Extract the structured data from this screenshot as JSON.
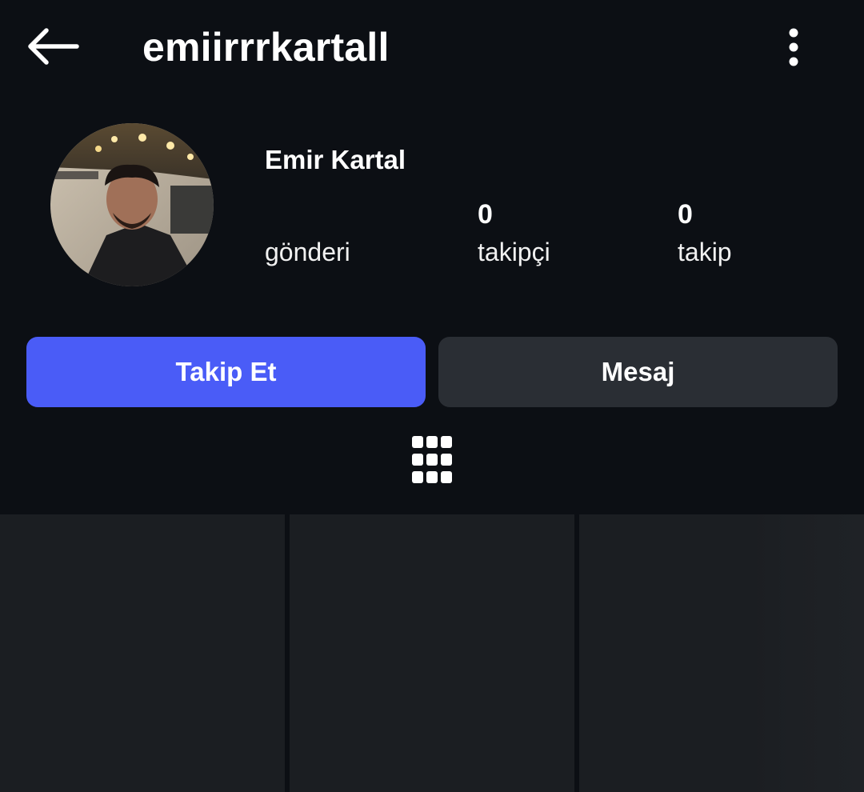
{
  "header": {
    "back_icon": "arrow-left-icon",
    "username": "emiirrrkartall",
    "more_icon": "more-vertical-icon"
  },
  "profile": {
    "display_name": "Emir Kartal",
    "avatar": "profile-photo",
    "stats": {
      "posts": {
        "value": "",
        "label": "gönderi"
      },
      "followers": {
        "value": "0",
        "label": "takipçi"
      },
      "following": {
        "value": "0",
        "label": "takip"
      }
    }
  },
  "actions": {
    "follow_label": "Takip Et",
    "message_label": "Mesaj"
  },
  "tabs": {
    "grid_icon": "grid-icon"
  },
  "colors": {
    "background": "#0c0f14",
    "follow_button": "#4a5cf7",
    "message_button": "#2a2e34",
    "post_tile": "#1b1e22"
  }
}
